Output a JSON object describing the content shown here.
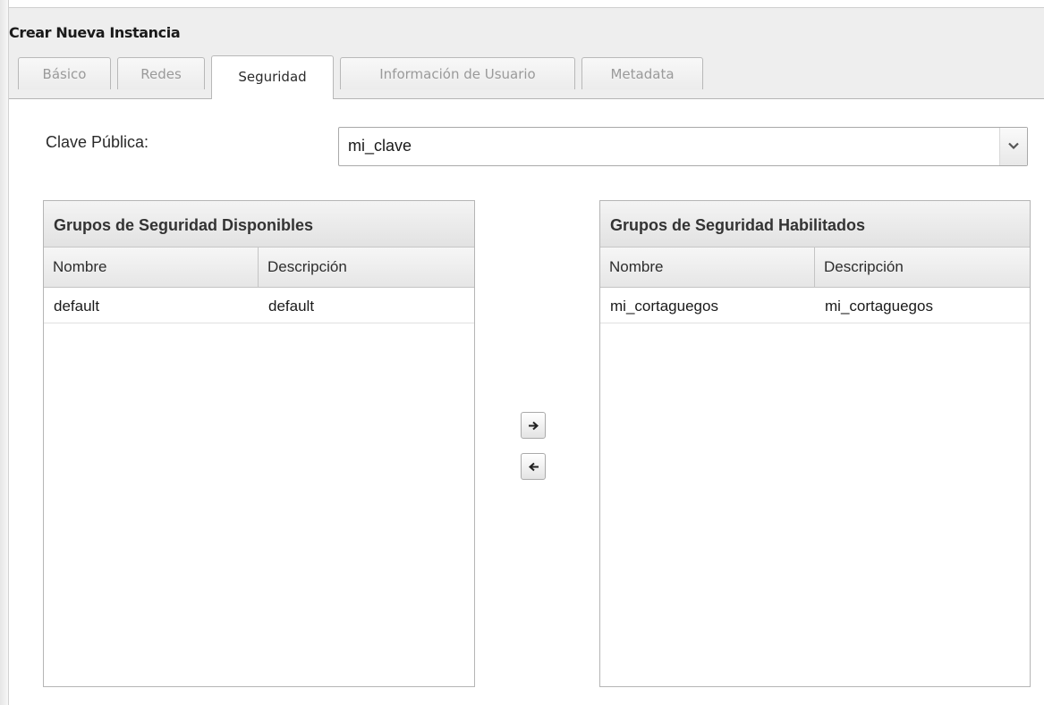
{
  "window": {
    "title": "Crear Nueva Instancia"
  },
  "tabs": [
    {
      "label": "Básico",
      "active": false
    },
    {
      "label": "Redes",
      "active": false
    },
    {
      "label": "Seguridad",
      "active": true
    },
    {
      "label": "Información de Usuario",
      "active": false
    },
    {
      "label": "Metadata",
      "active": false
    }
  ],
  "public_key": {
    "label": "Clave Pública:",
    "selected": "mi_clave"
  },
  "available_groups": {
    "title": "Grupos de Seguridad Disponibles",
    "columns": [
      "Nombre",
      "Descripción"
    ],
    "rows": [
      {
        "name": "default",
        "description": "default"
      }
    ]
  },
  "enabled_groups": {
    "title": "Grupos de Seguridad Habilitados",
    "columns": [
      "Nombre",
      "Descripción"
    ],
    "rows": [
      {
        "name": "mi_cortaguegos",
        "description": "mi_cortaguegos"
      }
    ]
  },
  "buttons": {
    "move_right_icon": "arrow-right-icon",
    "move_left_icon": "arrow-left-icon"
  },
  "colors": {
    "tab_active_text": "#2b2b2b",
    "tab_inactive_text": "#9a9a9a",
    "header_bg": "#eeeeee"
  }
}
